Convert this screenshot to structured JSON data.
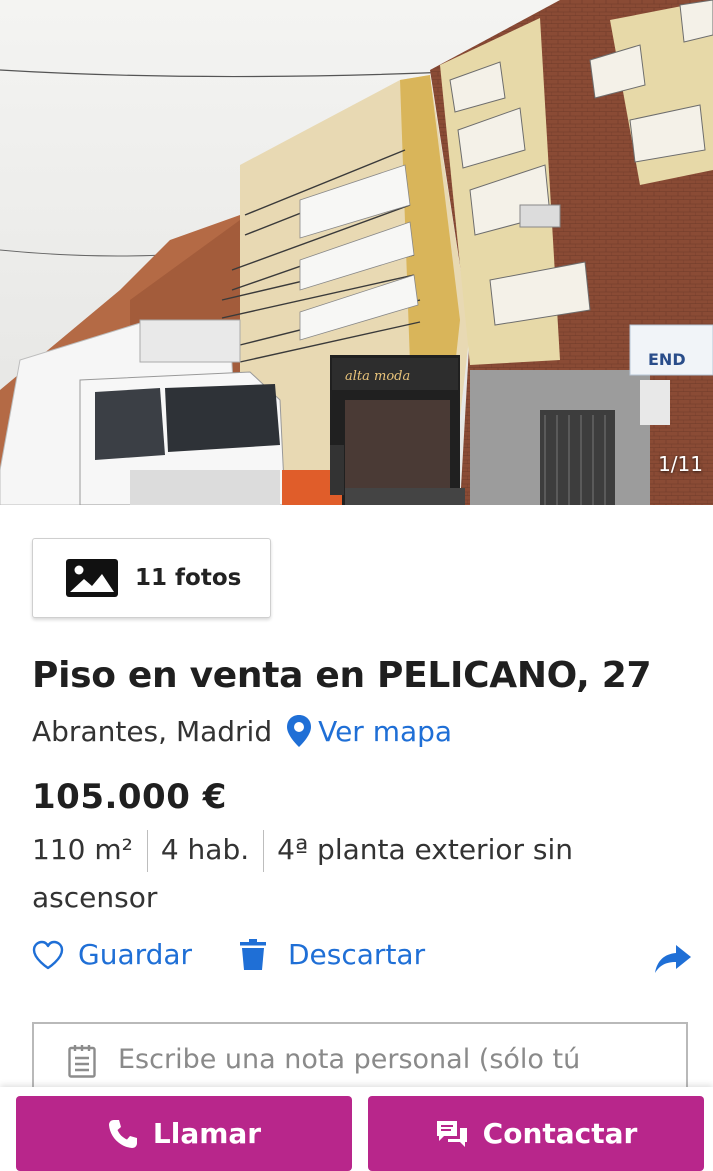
{
  "gallery": {
    "counter": "1/11",
    "photos_button_label": "11 fotos"
  },
  "listing": {
    "title": "Piso en venta en PELICANO, 27",
    "location": "Abrantes, Madrid",
    "map_link": "Ver mapa",
    "price": "105.000 €",
    "features": [
      "110 m²",
      "4 hab.",
      "4ª planta exterior sin ascensor"
    ]
  },
  "actions": {
    "save_label": "Guardar",
    "discard_label": "Descartar"
  },
  "note": {
    "placeholder": "Escribe una nota personal (sólo tú"
  },
  "bottom_bar": {
    "call_label": "Llamar",
    "contact_label": "Contactar"
  },
  "colors": {
    "link_blue": "#1f6fd6",
    "cta_magenta": "#b8268b",
    "text_dark": "#1f1f1f"
  },
  "icons": [
    "image-icon",
    "map-pin-icon",
    "heart-icon",
    "trash-icon",
    "share-icon",
    "note-icon",
    "phone-icon",
    "chat-icon"
  ]
}
